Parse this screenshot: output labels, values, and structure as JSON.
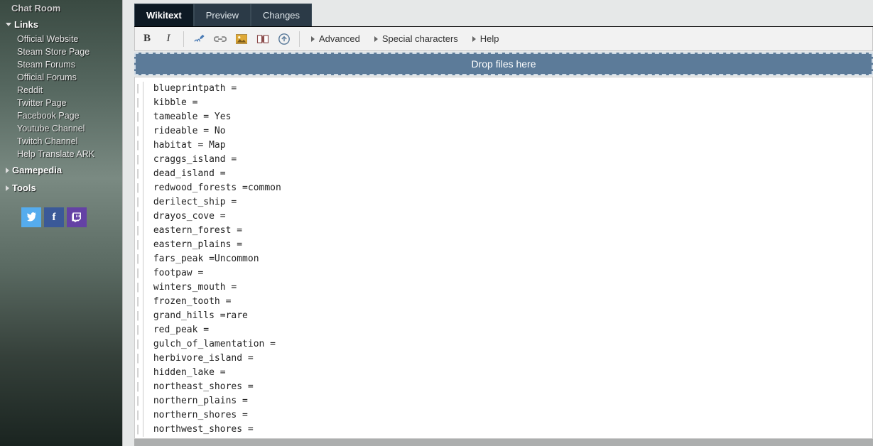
{
  "sidebar": {
    "top_item": "Chat Room",
    "links_header": "Links",
    "links": [
      "Official Website",
      "Steam Store Page",
      "Steam Forums",
      "Official Forums",
      "Reddit",
      "Twitter Page",
      "Facebook Page",
      "Youtube Channel",
      "Twitch Channel",
      "Help Translate ARK"
    ],
    "gamepedia_header": "Gamepedia",
    "tools_header": "Tools"
  },
  "tabs": {
    "wikitext": "Wikitext",
    "preview": "Preview",
    "changes": "Changes"
  },
  "toolbar": {
    "advanced": "Advanced",
    "special": "Special characters",
    "help": "Help"
  },
  "dropzone": "Drop files here",
  "editor_lines": [
    "blueprintpath =",
    "kibble =",
    "tameable = Yes",
    "rideable = No",
    "habitat = Map",
    "craggs_island =",
    "dead_island =",
    "redwood_forests =common",
    "derilect_ship =",
    "drayos_cove =",
    "eastern_forest =",
    "eastern_plains =",
    "fars_peak =Uncommon",
    "footpaw =",
    "winters_mouth =",
    "frozen_tooth =",
    "grand_hills =rare",
    "red_peak =",
    "gulch_of_lamentation =",
    "herbivore_island =",
    "hidden_lake =",
    "northeast_shores =",
    "northern_plains =",
    "northern_shores =",
    "northwest_shores ="
  ]
}
